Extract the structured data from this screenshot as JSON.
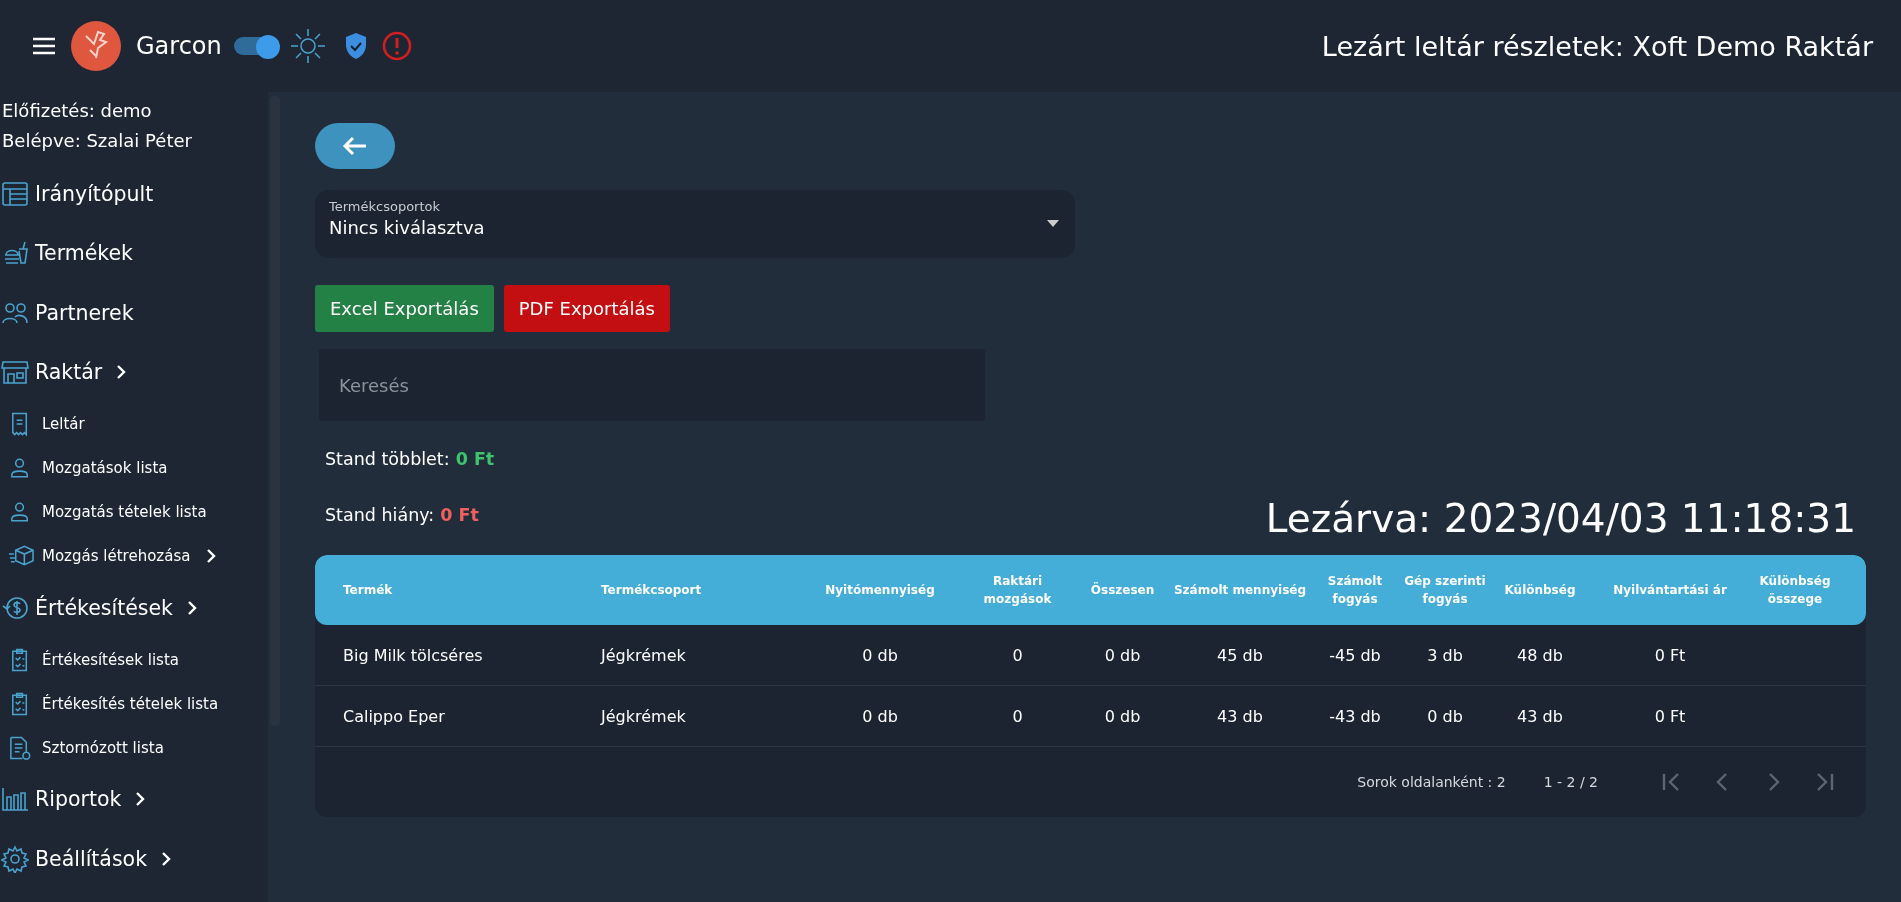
{
  "header": {
    "app_name": "Garcon",
    "theme_toggle": {
      "on": true
    },
    "page_title": "Lezárt leltár részletek: Xoft Demo Raktár"
  },
  "sidebar": {
    "subscription": "Előfizetés: demo",
    "user": "Belépve: Szalai Péter",
    "items": [
      {
        "label": "Irányítópult",
        "expandable": false
      },
      {
        "label": "Termékek",
        "expandable": false
      },
      {
        "label": "Partnerek",
        "expandable": false
      },
      {
        "label": "Raktár",
        "expandable": true,
        "children": [
          {
            "label": "Leltár",
            "expandable": false
          },
          {
            "label": "Mozgatások lista",
            "expandable": false
          },
          {
            "label": "Mozgatás tételek lista",
            "expandable": false
          },
          {
            "label": "Mozgás létrehozása",
            "expandable": true
          }
        ]
      },
      {
        "label": "Értékesítések",
        "expandable": true,
        "children": [
          {
            "label": "Értékesítések lista",
            "expandable": false
          },
          {
            "label": "Értékesítés tételek lista",
            "expandable": false
          },
          {
            "label": "Sztornózott lista",
            "expandable": false
          }
        ]
      },
      {
        "label": "Riportok",
        "expandable": true
      },
      {
        "label": "Beállítások",
        "expandable": true
      }
    ]
  },
  "filter": {
    "label": "Termékcsoportok",
    "value": "Nincs kiválasztva"
  },
  "export_buttons": [
    {
      "label": "Excel Exportálás",
      "kind": "excel"
    },
    {
      "label": "PDF Exportálás",
      "kind": "pdf"
    }
  ],
  "search": {
    "placeholder": "Keresés"
  },
  "summary": [
    {
      "label": "Stand többlet:",
      "value": "0 Ft",
      "kind": "surplus"
    },
    {
      "label": "Stand hiány:",
      "value": "0 Ft",
      "kind": "shortage"
    }
  ],
  "closed_at": "Lezárva: 2023/04/03 11:18:31",
  "table": {
    "columns": [
      "Termék",
      "Termékcsoport",
      "Nyitómennyiség",
      "Raktári mozgások",
      "Összesen",
      "Számolt mennyiség",
      "Számolt fogyás",
      "Gép szerinti fogyás",
      "Különbség",
      "Nyilvántartási ár",
      "Különbség összege"
    ],
    "rows": [
      [
        "Big Milk tölcséres",
        "Jégkrémek",
        "0 db",
        "0",
        "0 db",
        "45 db",
        "-45 db",
        "3 db",
        "48 db",
        "0 Ft"
      ],
      [
        "Calippo Eper",
        "Jégkrémek",
        "0 db",
        "0",
        "0 db",
        "43 db",
        "-43 db",
        "0 db",
        "43 db",
        "0 Ft"
      ]
    ]
  },
  "pagination": {
    "rows_per_page": "Sorok oldalanként : 2",
    "range": "1 - 2 / 2",
    "buttons": [
      {
        "kind": "first",
        "disabled": true
      },
      {
        "kind": "prev",
        "disabled": true
      },
      {
        "kind": "next",
        "disabled": true
      },
      {
        "kind": "last",
        "disabled": true
      }
    ]
  }
}
